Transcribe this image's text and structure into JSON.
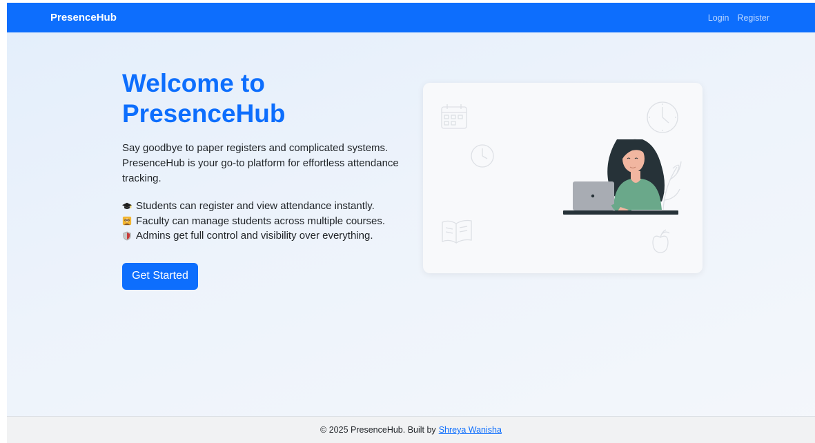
{
  "navbar": {
    "brand": "PresenceHub",
    "links": [
      {
        "label": "Login"
      },
      {
        "label": "Register"
      }
    ]
  },
  "hero": {
    "title": "Welcome to PresenceHub",
    "description": "Say goodbye to paper registers and complicated systems. PresenceHub is your go-to platform for effortless attendance tracking.",
    "features": [
      {
        "icon": "graduation-cap-icon",
        "text": "Students can register and view attendance instantly."
      },
      {
        "icon": "teacher-icon",
        "text": "Faculty can manage students across multiple courses."
      },
      {
        "icon": "shield-icon",
        "text": "Admins get full control and visibility over everything."
      }
    ],
    "cta_label": "Get Started"
  },
  "footer": {
    "text": "© 2025 PresenceHub. Built by",
    "author_link": "Shreya Wanisha"
  },
  "colors": {
    "primary": "#0d6efd",
    "text": "#212529",
    "footer_bg": "#f1f2f3",
    "shirt": "#6aa88a",
    "hair": "#263238"
  }
}
